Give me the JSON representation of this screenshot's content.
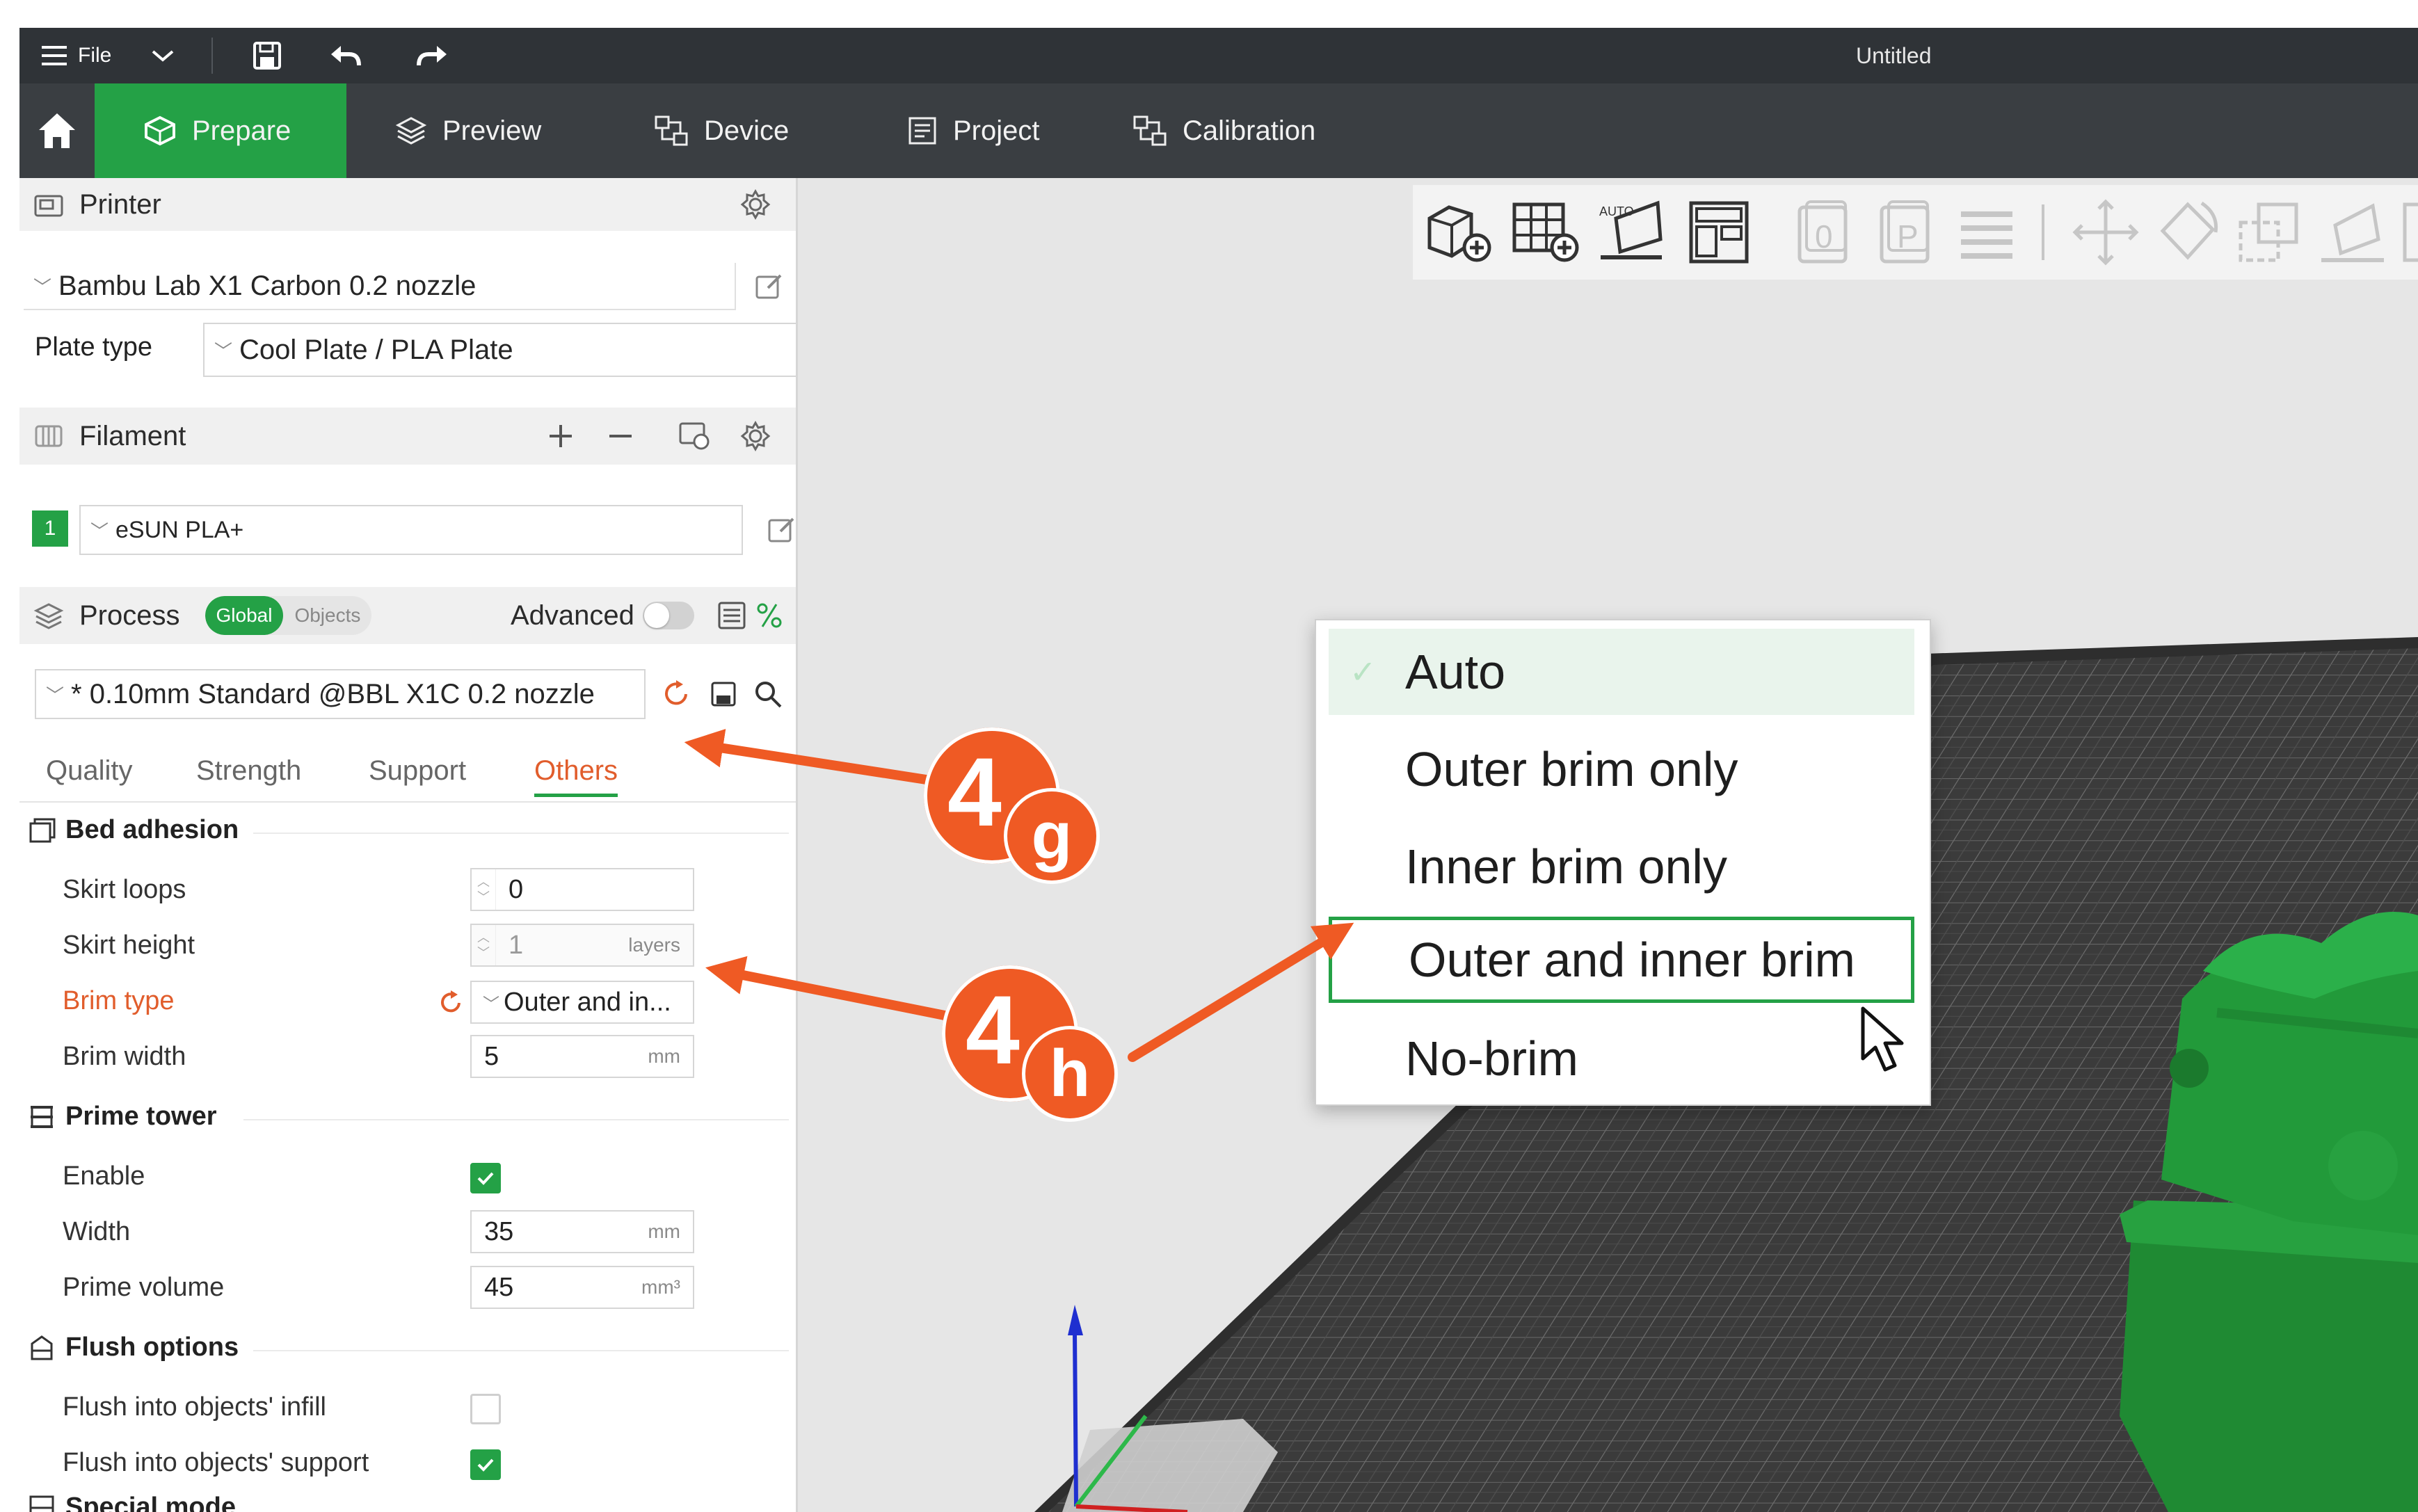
{
  "window": {
    "title": "Untitled",
    "file_menu_label": "File"
  },
  "nav": {
    "tabs": [
      {
        "label": "Prepare"
      },
      {
        "label": "Preview"
      },
      {
        "label": "Device"
      },
      {
        "label": "Project"
      },
      {
        "label": "Calibration"
      }
    ]
  },
  "printer": {
    "section_label": "Printer",
    "preset": "Bambu Lab X1 Carbon 0.2 nozzle",
    "plate_type_label": "Plate type",
    "plate_type_value": "Cool Plate / PLA Plate"
  },
  "filament": {
    "section_label": "Filament",
    "slot_number": "1",
    "slot_color": "#24a146",
    "preset": "eSUN PLA+"
  },
  "process": {
    "section_label": "Process",
    "scope_options": [
      "Global",
      "Objects"
    ],
    "scope_selected": "Global",
    "advanced_label": "Advanced",
    "advanced_on": false,
    "preset": "* 0.10mm Standard @BBL X1C 0.2 nozzle",
    "tabs": [
      "Quality",
      "Strength",
      "Support",
      "Others"
    ],
    "active_tab": "Others"
  },
  "bed_adhesion": {
    "title": "Bed adhesion",
    "skirt_loops": {
      "label": "Skirt loops",
      "value": "0"
    },
    "skirt_height": {
      "label": "Skirt height",
      "value": "1",
      "unit": "layers"
    },
    "brim_type": {
      "label": "Brim type",
      "value": "Outer and in..."
    },
    "brim_width": {
      "label": "Brim width",
      "value": "5",
      "unit": "mm"
    }
  },
  "prime_tower": {
    "title": "Prime tower",
    "enable": {
      "label": "Enable",
      "checked": true
    },
    "width": {
      "label": "Width",
      "value": "35",
      "unit": "mm"
    },
    "prime_volume": {
      "label": "Prime volume",
      "value": "45",
      "unit": "mm³"
    }
  },
  "flush_options": {
    "title": "Flush options",
    "infill": {
      "label": "Flush into objects' infill",
      "checked": false
    },
    "support": {
      "label": "Flush into objects' support",
      "checked": true
    }
  },
  "special_mode": {
    "title": "Special mode"
  },
  "brim_dropdown": {
    "options": [
      "Auto",
      "Outer brim only",
      "Inner brim only",
      "Outer and inner brim",
      "No-brim"
    ],
    "highlighted": "Auto",
    "selected": "Outer and inner brim"
  },
  "annotations": [
    {
      "number": "4",
      "letter": "g"
    },
    {
      "number": "4",
      "letter": "h"
    }
  ],
  "colors": {
    "accent_green": "#24a146",
    "callout_orange": "#ef5a24",
    "warning_text": "#e15d2c"
  }
}
